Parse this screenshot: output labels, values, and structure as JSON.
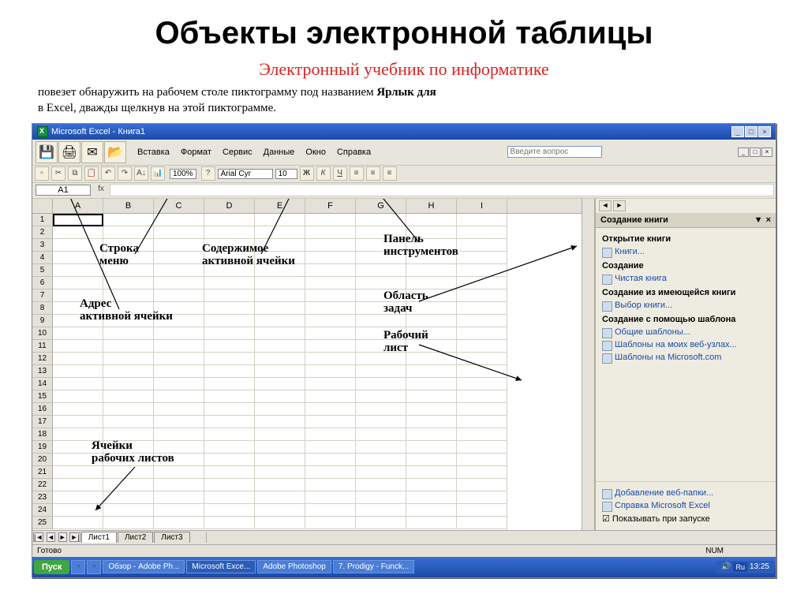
{
  "slide": {
    "title": "Объекты электронной таблицы",
    "subtitle": "Электронный учебник по информатике",
    "intro_line1": "повезет обнаружить на рабочем столе пиктограмму под названием ",
    "intro_bold": "Ярлык для",
    "intro_line2": "в Excel, дважды щелкнув на этой пиктограмме."
  },
  "window": {
    "title": "Microsoft Excel - Книга1"
  },
  "menu": {
    "items": [
      "Вставка",
      "Формат",
      "Сервис",
      "Данные",
      "Окно",
      "Справка"
    ],
    "help_placeholder": "Введите вопрос"
  },
  "toolbar": {
    "zoom": "100%",
    "font": "Arial Cyr",
    "font_size": "10"
  },
  "formula": {
    "cell_ref": "A1"
  },
  "columns": [
    "A",
    "B",
    "C",
    "D",
    "E",
    "F",
    "G",
    "H",
    "I"
  ],
  "task_pane": {
    "title": "Создание книги",
    "sec1": "Открытие книги",
    "link1": "Книги...",
    "sec2": "Создание",
    "link2": "Чистая книга",
    "sec3": "Создание из имеющейся книги",
    "link3": "Выбор книги...",
    "sec4": "Создание с помощью шаблона",
    "link4": "Общие шаблоны...",
    "link5": "Шаблоны на моих веб-узлах...",
    "link6": "Шаблоны на Microsoft.com",
    "bottom1": "Добавление веб-папки...",
    "bottom2": "Справка Microsoft Excel",
    "bottom3": "Показывать при запуске"
  },
  "sheets": {
    "s1": "Лист1",
    "s2": "Лист2",
    "s3": "Лист3"
  },
  "status": {
    "ready": "Готово",
    "num": "NUM"
  },
  "taskbar": {
    "start": "Пуск",
    "items": [
      "Обзор - Adobe Ph...",
      "Microsoft Exce...",
      "Adobe Photoshop",
      "7. Prodigy - Funck..."
    ],
    "lang": "Ru",
    "time": "13:25"
  },
  "callouts": {
    "c1a": "Строка",
    "c1b": "меню",
    "c2a": "Содержимое",
    "c2b": "активной ячейки",
    "c3a": "Панель",
    "c3b": "инструментов",
    "c4a": "Адрес",
    "c4b": "активной ячейки",
    "c5a": "Область",
    "c5b": "задач",
    "c6a": "Рабочий",
    "c6b": "лист",
    "c7a": "Ячейки",
    "c7b": "рабочих листов"
  }
}
